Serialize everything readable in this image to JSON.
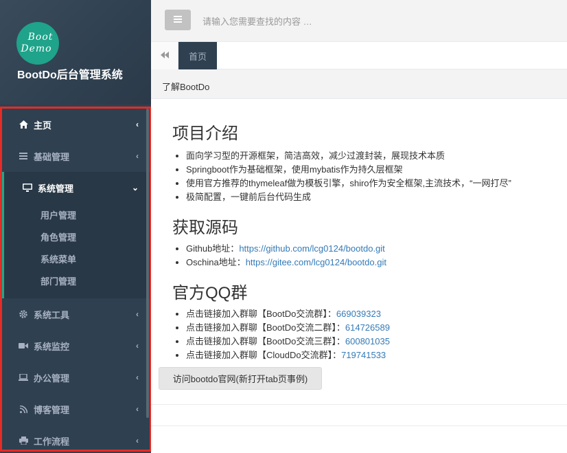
{
  "app": {
    "logo_line1": "Boot",
    "logo_line2": "Demo",
    "title": "BootDo后台管理系统"
  },
  "topbar": {
    "search_placeholder": "请输入您需要查找的内容 …"
  },
  "tabs": {
    "home_label": "首页"
  },
  "breadcrumb": {
    "label": "了解BootDo"
  },
  "sidebar": {
    "items": [
      {
        "label": "主页",
        "icon": "home-icon"
      },
      {
        "label": "基础管理",
        "icon": "bars-icon"
      },
      {
        "label": "系统管理",
        "icon": "desktop-icon",
        "expanded": true
      },
      {
        "label": "系统工具",
        "icon": "gear-icon"
      },
      {
        "label": "系统监控",
        "icon": "video-icon"
      },
      {
        "label": "办公管理",
        "icon": "laptop-icon"
      },
      {
        "label": "博客管理",
        "icon": "rss-icon"
      },
      {
        "label": "工作流程",
        "icon": "print-icon"
      }
    ],
    "sub_items": [
      "用户管理",
      "角色管理",
      "系统菜单",
      "部门管理"
    ]
  },
  "content": {
    "intro_title": "项目介绍",
    "intro_items": [
      "面向学习型的开源框架，简洁高效，减少过渡封装，展现技术本质",
      "Springboot作为基础框架，使用mybatis作为持久层框架",
      "使用官方推荐的thymeleaf做为模板引擎，shiro作为安全框架,主流技术，“一网打尽”",
      "极简配置，一键前后台代码生成"
    ],
    "source_title": "获取源码",
    "source_items": [
      {
        "label": "Github地址：",
        "link": "https://github.com/lcg0124/bootdo.git"
      },
      {
        "label": "Oschina地址：",
        "link": "https://gitee.com/lcg0124/bootdo.git"
      }
    ],
    "qq_title": "官方QQ群",
    "qq_items": [
      {
        "label": "点击链接加入群聊【BootDo交流群】：",
        "number": "669039323"
      },
      {
        "label": "点击链接加入群聊【BootDo交流二群】：",
        "number": "614726589"
      },
      {
        "label": "点击链接加入群聊【BootDo交流三群】：",
        "number": "600801035"
      },
      {
        "label": "点击链接加入群聊【CloudDo交流群】：",
        "number": "719741533"
      }
    ],
    "visit_button": "访问bootdo官网(新打开tab页事例)"
  },
  "colors": {
    "sidebar_bg": "#2f4050",
    "accent": "#19aa8d",
    "highlight_border": "#e62b26",
    "link": "#337ab7"
  }
}
